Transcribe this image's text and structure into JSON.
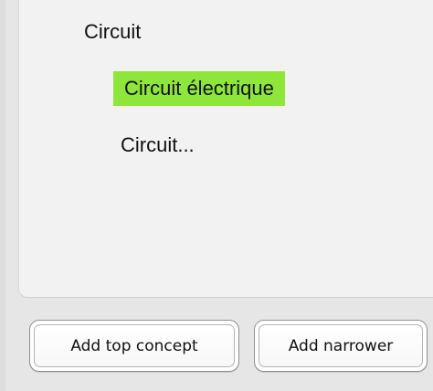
{
  "tree": {
    "root_label": "Circuit",
    "selected_label": "Circuit électrique",
    "child_label": "Circuit..."
  },
  "buttons": {
    "add_top_concept": "Add top concept",
    "add_narrower": "Add narrower"
  },
  "colors": {
    "selection_highlight": "#8ee63a",
    "panel_background": "#f2f2f2",
    "window_background": "#e6e6e6"
  }
}
